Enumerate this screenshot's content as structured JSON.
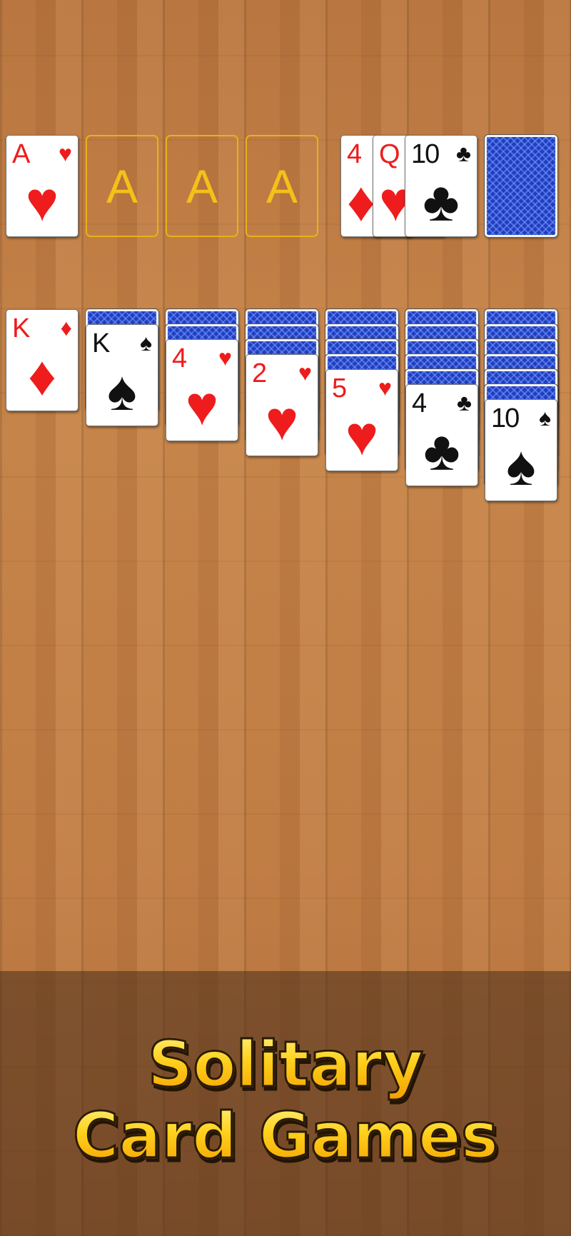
{
  "foundations": {
    "hearts": {
      "rank": "A",
      "suit": "♥",
      "color": "red"
    },
    "empty_label": "A"
  },
  "waste": [
    {
      "rank": "4",
      "suit": "♦",
      "color": "red"
    },
    {
      "rank": "Q",
      "suit": "♥",
      "color": "red"
    },
    {
      "rank": "10",
      "suit": "♣",
      "color": "black"
    }
  ],
  "stock": {
    "face_down": true
  },
  "tableau": [
    {
      "hidden": 0,
      "top": {
        "rank": "K",
        "suit": "♦",
        "color": "red"
      }
    },
    {
      "hidden": 1,
      "top": {
        "rank": "K",
        "suit": "♠",
        "color": "black"
      }
    },
    {
      "hidden": 2,
      "top": {
        "rank": "4",
        "suit": "♥",
        "color": "red"
      }
    },
    {
      "hidden": 3,
      "top": {
        "rank": "2",
        "suit": "♥",
        "color": "red"
      }
    },
    {
      "hidden": 4,
      "top": {
        "rank": "5",
        "suit": "♥",
        "color": "red"
      }
    },
    {
      "hidden": 5,
      "top": {
        "rank": "4",
        "suit": "♣",
        "color": "black"
      }
    },
    {
      "hidden": 6,
      "top": {
        "rank": "10",
        "suit": "♠",
        "color": "black"
      }
    }
  ],
  "banner": {
    "line1": "Solitary",
    "line2": "Card Games"
  },
  "colors": {
    "red": "#ee1c1c",
    "black": "#111111",
    "card_back": "#1f3fbf",
    "foundation_outline": "#e8b11a"
  }
}
